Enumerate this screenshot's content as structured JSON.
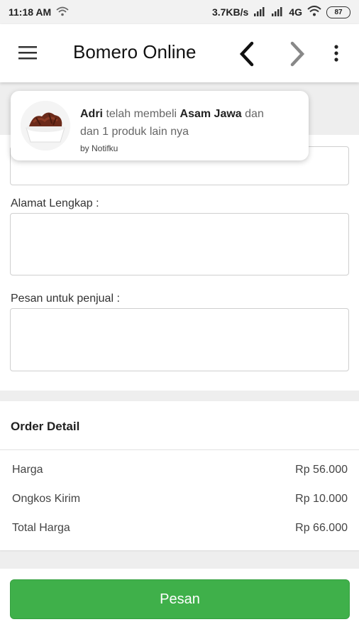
{
  "status_bar": {
    "time": "11:18 AM",
    "net_speed": "3.7KB/s",
    "network_type": "4G",
    "battery": "87"
  },
  "app_bar": {
    "title": "Bomero Online",
    "icons": [
      "menu-icon",
      "chevron-left-icon",
      "chevron-right-icon",
      "more-vertical-icon"
    ]
  },
  "notification": {
    "buyer": "Adri",
    "text_mid": "telah membeli",
    "product": "Asam Jawa",
    "text_end": "dan",
    "line2": "dan 1 produk lain nya",
    "by": "by Notifku"
  },
  "form": {
    "address_label": "Alamat Lengkap :",
    "message_label": "Pesan untuk penjual :"
  },
  "order_detail": {
    "title": "Order Detail",
    "rows": [
      {
        "label": "Harga",
        "value": "Rp 56.000"
      },
      {
        "label": "Ongkos Kirim",
        "value": "Rp 10.000"
      },
      {
        "label": "Total Harga",
        "value": "Rp 66.000"
      }
    ]
  },
  "actions": {
    "order_button": "Pesan"
  },
  "colors": {
    "accent_green": "#3fb04a"
  }
}
